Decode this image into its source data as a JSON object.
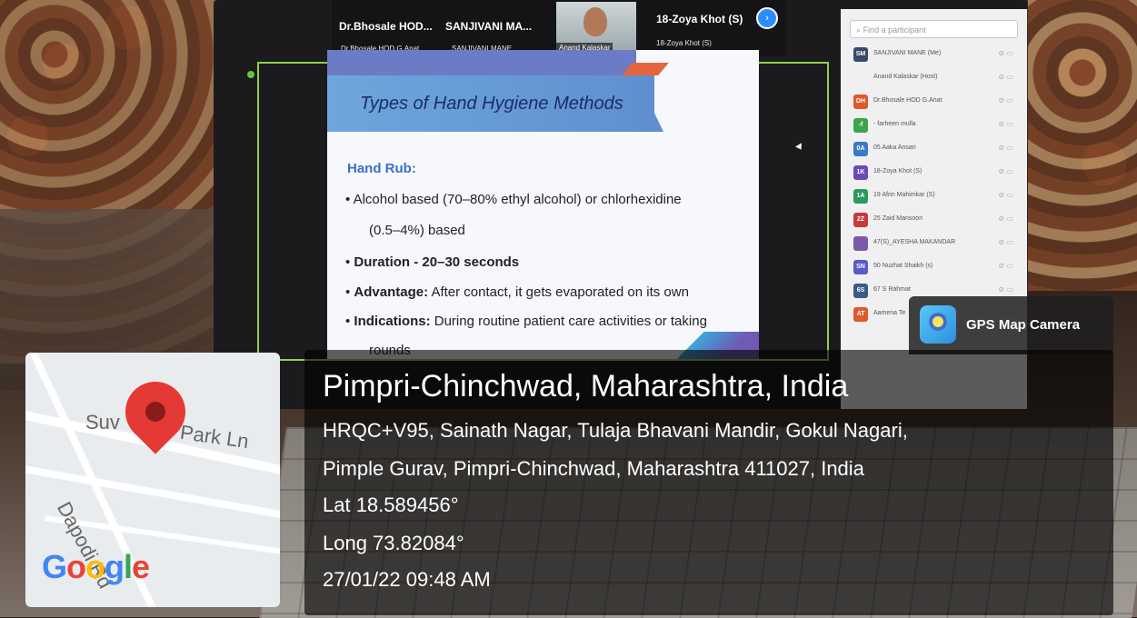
{
  "zoom": {
    "tiles": [
      {
        "name": "Dr.Bhosale HOD...",
        "sub": "Dr.Bhosale HOD G.Anat"
      },
      {
        "name": "SANJIVANI MA...",
        "sub": "SANJIVANI MANE"
      },
      {
        "name": "",
        "sub": "Anand Kalaskar"
      },
      {
        "name": "18-Zoya Khot (S)",
        "sub": "18-Zoya Khot (S)"
      }
    ]
  },
  "slide": {
    "title": "Types of Hand Hygiene Methods",
    "heading": "Hand Rub:",
    "bullets": [
      {
        "lead": "",
        "text": "Alcohol based (70–80% ethyl alcohol) or chlorhexidine"
      },
      {
        "lead": "",
        "text": "(0.5–4%) based"
      },
      {
        "lead": "Duration - 20–30 seconds",
        "text": ""
      },
      {
        "lead": "Advantage:",
        "text": " After contact, it gets evaporated on its own"
      },
      {
        "lead": "Indications:",
        "text": " During routine patient care activities or taking"
      },
      {
        "lead": "",
        "text": "rounds"
      }
    ]
  },
  "panel": {
    "search_placeholder": "Find a participant",
    "participants": [
      {
        "initials": "SM",
        "color": "#3a4a6a",
        "name": "SANJIVANI MANE (Me)"
      },
      {
        "initials": "",
        "color": "#f0f0f2",
        "name": "Anand Kalaskar (Host)"
      },
      {
        "initials": "DH",
        "color": "#e0582b",
        "name": "Dr.Bhosale HOD G.Anat"
      },
      {
        "initials": "-f",
        "color": "#3aa64a",
        "name": "- farheen mulla"
      },
      {
        "initials": "0A",
        "color": "#3a7ac8",
        "name": "05 Aaka Ansari"
      },
      {
        "initials": "1K",
        "color": "#6a4ab8",
        "name": "18-Zoya Khot (S)"
      },
      {
        "initials": "1A",
        "color": "#2a9a5a",
        "name": "19 Afrin Mahimkar (S)"
      },
      {
        "initials": "2Z",
        "color": "#c83a3a",
        "name": "25 Zaid Mansoori"
      },
      {
        "initials": "",
        "color": "#7a5aa8",
        "name": "47(S)_AYESHA MAKANDAR"
      },
      {
        "initials": "SN",
        "color": "#5a5ac8",
        "name": "50 Nuzhat Shaikh (s)"
      },
      {
        "initials": "6S",
        "color": "#3a5a8a",
        "name": "67 S Rahmat"
      },
      {
        "initials": "AT",
        "color": "#e0582b",
        "name": "Aamena Te"
      }
    ]
  },
  "gps": {
    "badge": "GPS Map Camera",
    "place": "Pimpri-Chinchwad, Maharashtra, India",
    "address_line1": "HRQC+V95, Sainath Nagar, Tulaja Bhavani Mandir, Gokul Nagari,",
    "address_line2": "Pimple Gurav, Pimpri-Chinchwad, Maharashtra 411027, India",
    "lat": "Lat 18.589456°",
    "long": "Long 73.82084°",
    "datetime": "27/01/22 09:48 AM"
  },
  "map": {
    "labels": [
      "Suv",
      "Park Ln",
      "Dapodi Rd"
    ],
    "google_letters": [
      "G",
      "o",
      "o",
      "g",
      "l",
      "e"
    ],
    "google_colors": [
      "#4285f4",
      "#ea4335",
      "#fbbc05",
      "#4285f4",
      "#34a853",
      "#ea4335"
    ]
  }
}
